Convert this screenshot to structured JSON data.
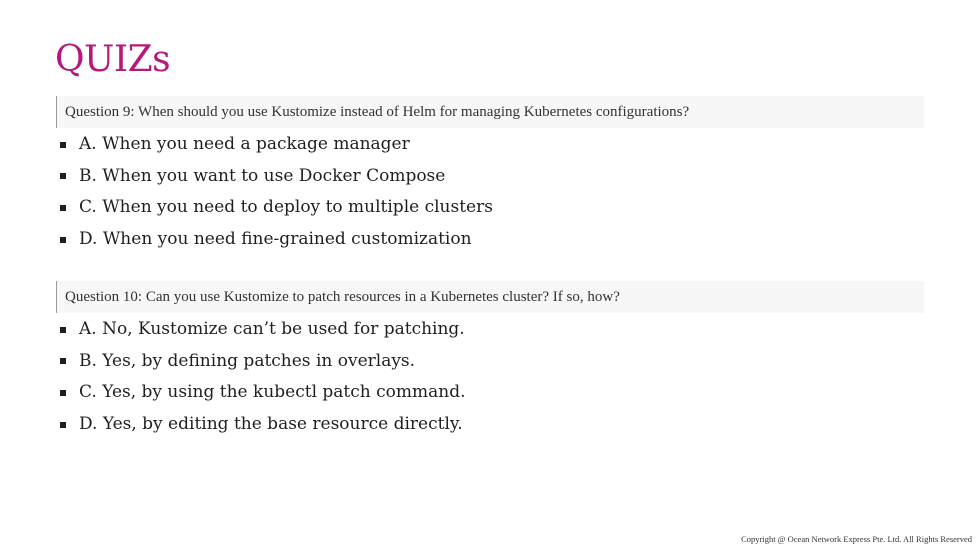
{
  "page_title": "QUIZs",
  "questions": [
    {
      "text": "Question 9: When should you use Kustomize instead of Helm for managing Kubernetes configurations?",
      "options": [
        "A. When you need a package manager",
        "B. When you want to use Docker Compose",
        "C. When you need to deploy to multiple clusters",
        "D. When you need fine-grained customization"
      ]
    },
    {
      "text": "Question 10: Can you use Kustomize to patch resources in a Kubernetes cluster? If so, how?",
      "options": [
        "A. No, Kustomize can’t be used for patching.",
        "B. Yes, by defining patches in overlays.",
        "C. Yes, by using the kubectl patch command.",
        "D. Yes, by editing the base resource directly."
      ]
    }
  ],
  "footer": {
    "copyright": "Copyright @ Ocean Network Express Pte. Ltd. All Rights Reserved"
  }
}
